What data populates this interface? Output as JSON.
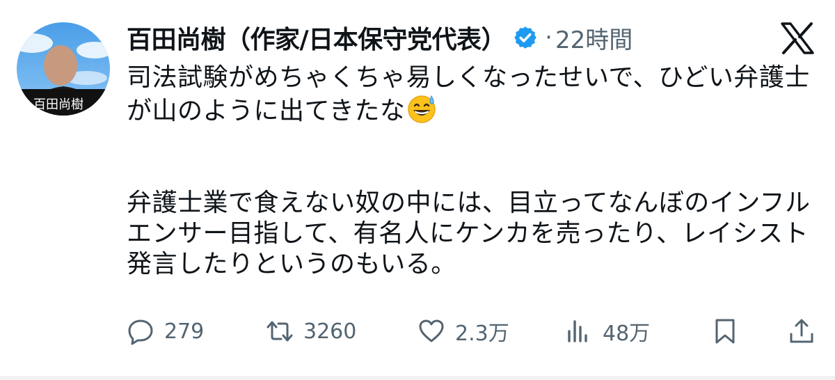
{
  "tweet": {
    "author": {
      "display_name": "百田尚樹（作家/日本保守党代表）",
      "avatar_label": "百田尚樹"
    },
    "dot": "·",
    "timestamp": "22時間",
    "paragraphs": [
      "司法試験がめちゃくちゃ易しくなったせいで、ひどい弁護士が山のように出てきたな",
      "弁護士業で食えない奴の中には、目立ってなんぼのインフルエンサー目指して、有名人にケンカを売ったり、レイシスト発言したりというのもいる。"
    ],
    "emoji": "grinning-face-with-sweat-icon"
  },
  "actions": {
    "replies": "279",
    "retweets": "3260",
    "likes": "2.3万",
    "views": "48万"
  },
  "colors": {
    "text": "#0f1419",
    "secondary": "#536471",
    "verified": "#1d9bf0"
  }
}
